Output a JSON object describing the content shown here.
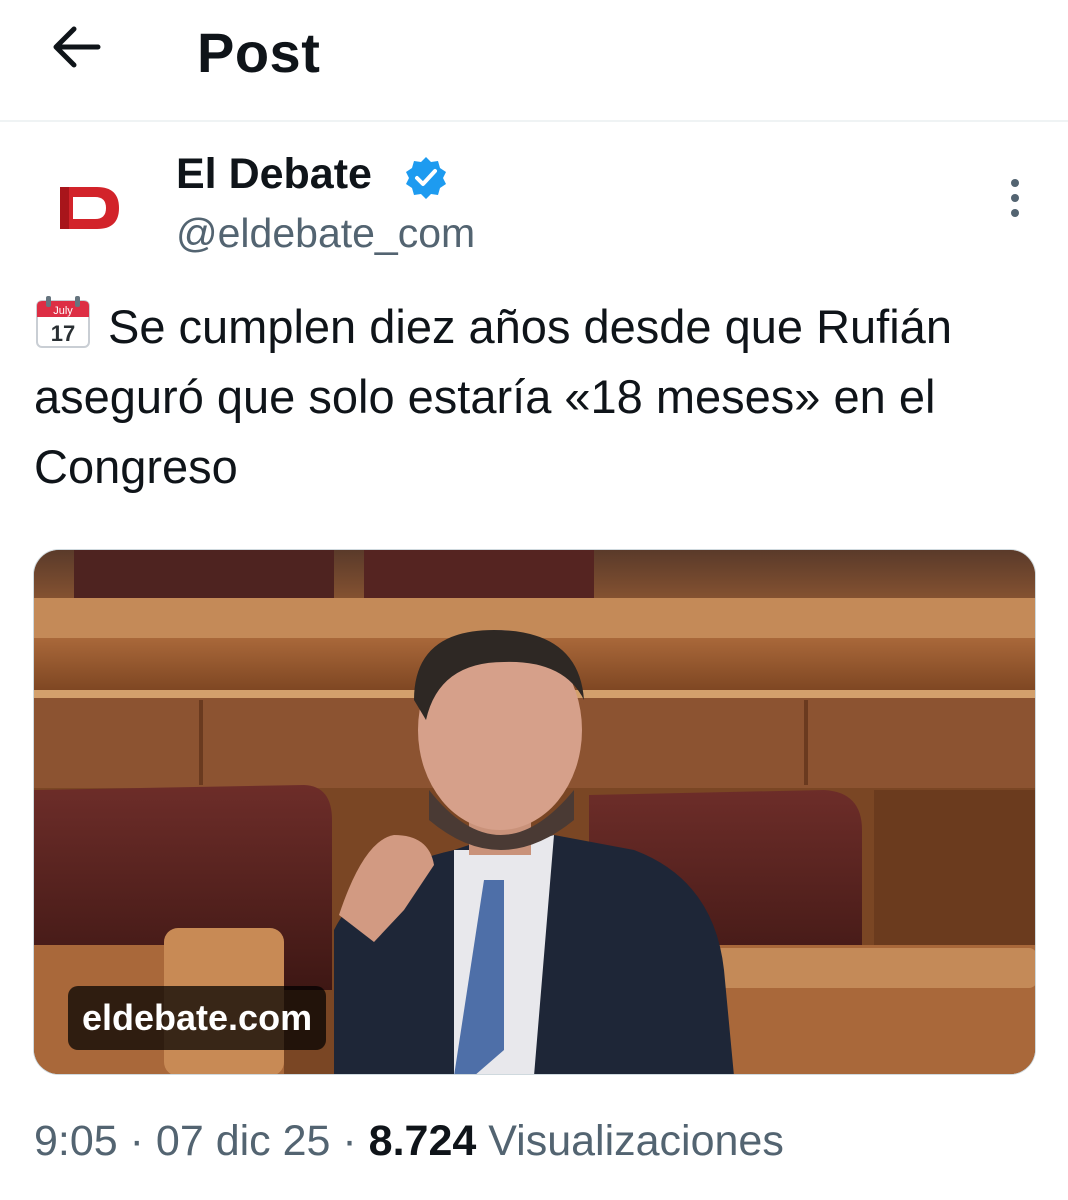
{
  "header": {
    "title": "Post"
  },
  "author": {
    "display_name": "El Debate",
    "handle": "@eldebate_com",
    "verified": true
  },
  "post": {
    "emoji": {
      "name": "calendar-icon",
      "month": "July",
      "day": "17"
    },
    "text": "Se cumplen diez años desde que Rufián aseguró que solo estaría «18 meses» en el Congreso"
  },
  "media": {
    "domain": "eldebate.com"
  },
  "meta": {
    "time": "9:05",
    "separator": " · ",
    "date": "07 dic 25",
    "views_count": "8.724",
    "views_label": "Visualizaciones"
  },
  "colors": {
    "text_primary": "#0f1419",
    "text_secondary": "#536471",
    "verified": "#1d9bf0",
    "brand": "#d2232a",
    "divider": "#eff3f4"
  }
}
